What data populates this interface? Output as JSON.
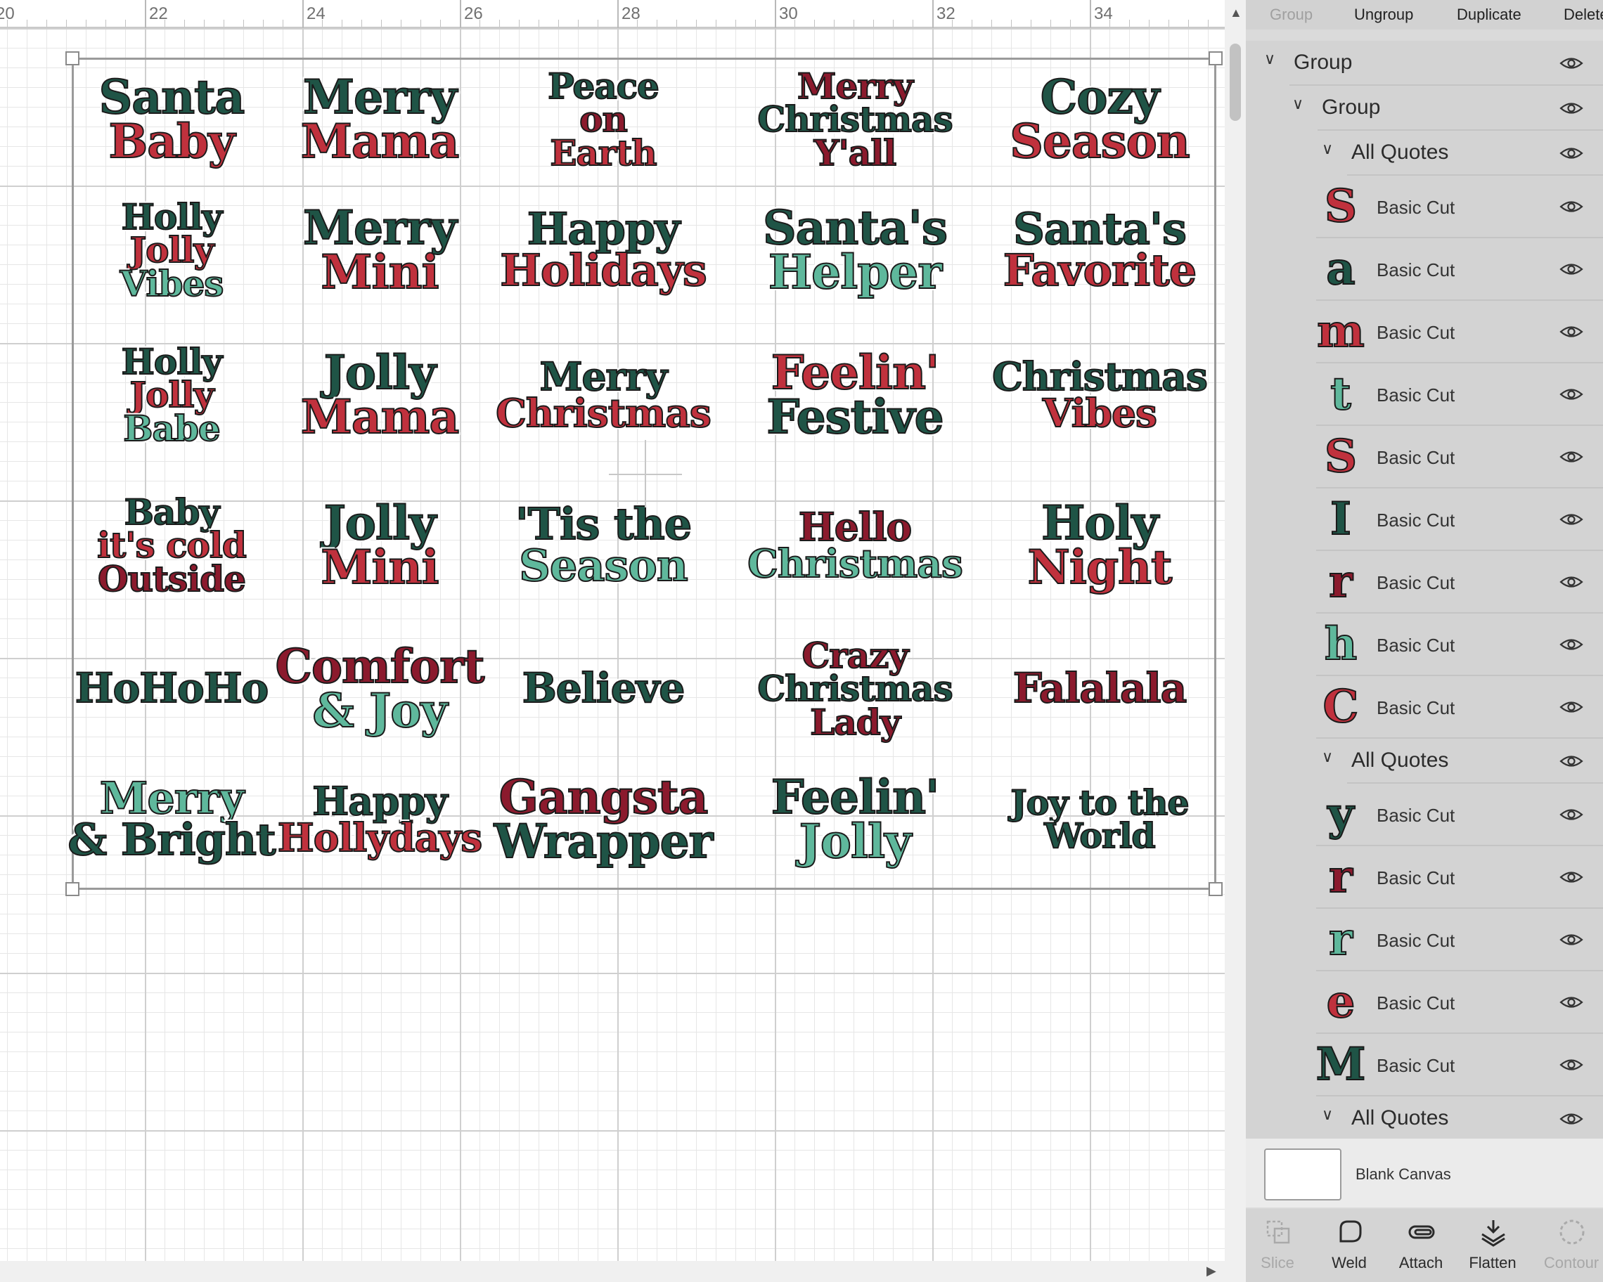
{
  "ruler": {
    "labels": [
      "20",
      "22",
      "24",
      "26",
      "28",
      "30",
      "32",
      "34"
    ]
  },
  "colors": {
    "dark_green": "#1f5446",
    "mint": "#5fb89c",
    "red": "#c0313d",
    "dark_red": "#8b1a2d"
  },
  "quotes": [
    [
      "Santa",
      "Baby"
    ],
    [
      "Merry",
      "Mama"
    ],
    [
      "Peace",
      "on",
      "Earth"
    ],
    [
      "Merry",
      "Christmas",
      "Y'all"
    ],
    [
      "Cozy",
      "Season"
    ],
    [
      "Holly",
      "Jolly",
      "Vibes"
    ],
    [
      "Merry",
      "Mini"
    ],
    [
      "Happy",
      "Holidays"
    ],
    [
      "Santa's",
      "Helper"
    ],
    [
      "Santa's",
      "Favorite"
    ],
    [
      "Holly",
      "Jolly",
      "Babe"
    ],
    [
      "Jolly",
      "Mama"
    ],
    [
      "Merry",
      "Christmas"
    ],
    [
      "Feelin'",
      "Festive"
    ],
    [
      "Christmas",
      "Vibes"
    ],
    [
      "Baby",
      "it's cold",
      "Outside"
    ],
    [
      "Jolly",
      "Mini"
    ],
    [
      "'Tis the",
      "Season"
    ],
    [
      "Hello",
      "Christmas"
    ],
    [
      "Holy",
      "Night"
    ],
    [
      "HoHoHo"
    ],
    [
      "Comfort",
      "& Joy"
    ],
    [
      "Believe"
    ],
    [
      "Crazy",
      "Christmas",
      "Lady"
    ],
    [
      "Falalala"
    ],
    [
      "Merry",
      "& Bright"
    ],
    [
      "Happy",
      "Hollydays"
    ],
    [
      "Gangsta",
      "Wrapper"
    ],
    [
      "Feelin'",
      "Jolly"
    ],
    [
      "Joy to the",
      "World"
    ]
  ],
  "toolbar": {
    "group": "Group",
    "ungroup": "Ungroup",
    "duplicate": "Duplicate",
    "delete": "Delete"
  },
  "layers": {
    "group_label": "Group",
    "subgroup_label": "Group",
    "all_quotes_label": "All Quotes",
    "cut_label": "Basic Cut",
    "set1": [
      "S",
      "a",
      "m",
      "t",
      "S",
      "I",
      "r",
      "h",
      "C"
    ],
    "set2": [
      "y",
      "r",
      "r",
      "e",
      "M"
    ]
  },
  "canvas_row": {
    "label": "Blank Canvas"
  },
  "actions": {
    "slice": "Slice",
    "weld": "Weld",
    "attach": "Attach",
    "flatten": "Flatten",
    "contour": "Contour"
  }
}
